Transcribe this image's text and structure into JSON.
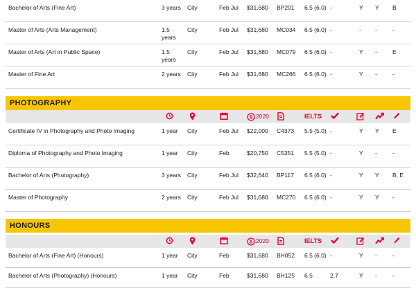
{
  "top_rows": [
    {
      "name": "Bachelor of Arts (Fine Art)",
      "duration": "3 years",
      "location": "City",
      "intake": "Feb Jul",
      "fee": "$31,680",
      "code": "BP201",
      "ielts": "6.5 (6.0)",
      "f1": "-",
      "f2": "Y",
      "f3": "Y",
      "f4": "B"
    },
    {
      "name": "Master of Arts (Arts Management)",
      "duration": "1.5 years",
      "location": "City",
      "intake": "Feb Jul",
      "fee": "$31,680",
      "code": "MC034",
      "ielts": "6.5 (6.0)",
      "f1": "-",
      "f2": "-",
      "f3": "-",
      "f4": "-"
    },
    {
      "name": "Master of Arts (Art in Public Space)",
      "duration": "1.5 years",
      "location": "City",
      "intake": "Feb Jul",
      "fee": "$31,680",
      "code": "MC079",
      "ielts": "6.5 (6.0)",
      "f1": "-",
      "f2": "Y",
      "f3": "-",
      "f4": "E"
    },
    {
      "name": "Master of Fine Art",
      "duration": "2 years",
      "location": "City",
      "intake": "Feb Jul",
      "fee": "$31,680",
      "code": "MC266",
      "ielts": "6.5 (6.0)",
      "f1": "-",
      "f2": "Y",
      "f3": "-",
      "f4": "-"
    }
  ],
  "icon_header": {
    "fee_year": "2020",
    "ielts_label": "IELTS",
    "icons": [
      "clock-icon",
      "location-pin-icon",
      "calendar-icon",
      "dollar-icon",
      "document-icon",
      "checkmark-icon",
      "edit-icon",
      "trend-up-icon",
      "pencil-icon"
    ]
  },
  "photography": {
    "title": "PHOTOGRAPHY",
    "rows": [
      {
        "name": "Certificate IV in Photography and Photo Imaging",
        "duration": "1 year",
        "location": "City",
        "intake": "Feb Jul",
        "fee": "$22,000",
        "code": "C4373",
        "ielts": "5.5 (5.0)",
        "f1": "-",
        "f2": "Y",
        "f3": "Y",
        "f4": "E"
      },
      {
        "name": "Diploma of Photography and Photo Imaging",
        "duration": "1 year",
        "location": "City",
        "intake": "Feb",
        "fee": "$20,750",
        "code": "C5351",
        "ielts": "5.5 (5.0)",
        "f1": "-",
        "f2": "Y",
        "f3": "-",
        "f4": "-"
      },
      {
        "name": "Bachelor of Arts (Photography)",
        "duration": "3 years",
        "location": "City",
        "intake": "Feb Jul",
        "fee": "$32,640",
        "code": "BP117",
        "ielts": "6.5 (6.0)",
        "f1": "-",
        "f2": "Y",
        "f3": "Y",
        "f4": "B, E"
      },
      {
        "name": "Master of Photography",
        "duration": "2 years",
        "location": "City",
        "intake": "Feb Jul",
        "fee": "$31,680",
        "code": "MC270",
        "ielts": "6.5 (6.0)",
        "f1": "-",
        "f2": "Y",
        "f3": "Y",
        "f4": "-"
      }
    ]
  },
  "honours": {
    "title": "HONOURS",
    "rows": [
      {
        "name": "Bachelor of Arts (Fine Art) (Honours)",
        "duration": "1 year",
        "location": "City",
        "intake": "Feb",
        "fee": "$31,680",
        "code": "BH052",
        "ielts": "6.5 (6.0)",
        "f1": "-",
        "f2": "Y",
        "f3": "-",
        "f4": "-"
      },
      {
        "name": "Bachelor of Arts (Photography) (Honours)",
        "duration": "1 year",
        "location": "City",
        "intake": "Feb",
        "fee": "$31,680",
        "code": "BH125",
        "ielts": "6.5",
        "f1": "2.7",
        "f2": "Y",
        "f3": "-",
        "f4": "-"
      }
    ]
  },
  "colors": {
    "accent": "#e4002b",
    "section_bar": "#f7c600",
    "icon_row": "#e6e6e6"
  }
}
